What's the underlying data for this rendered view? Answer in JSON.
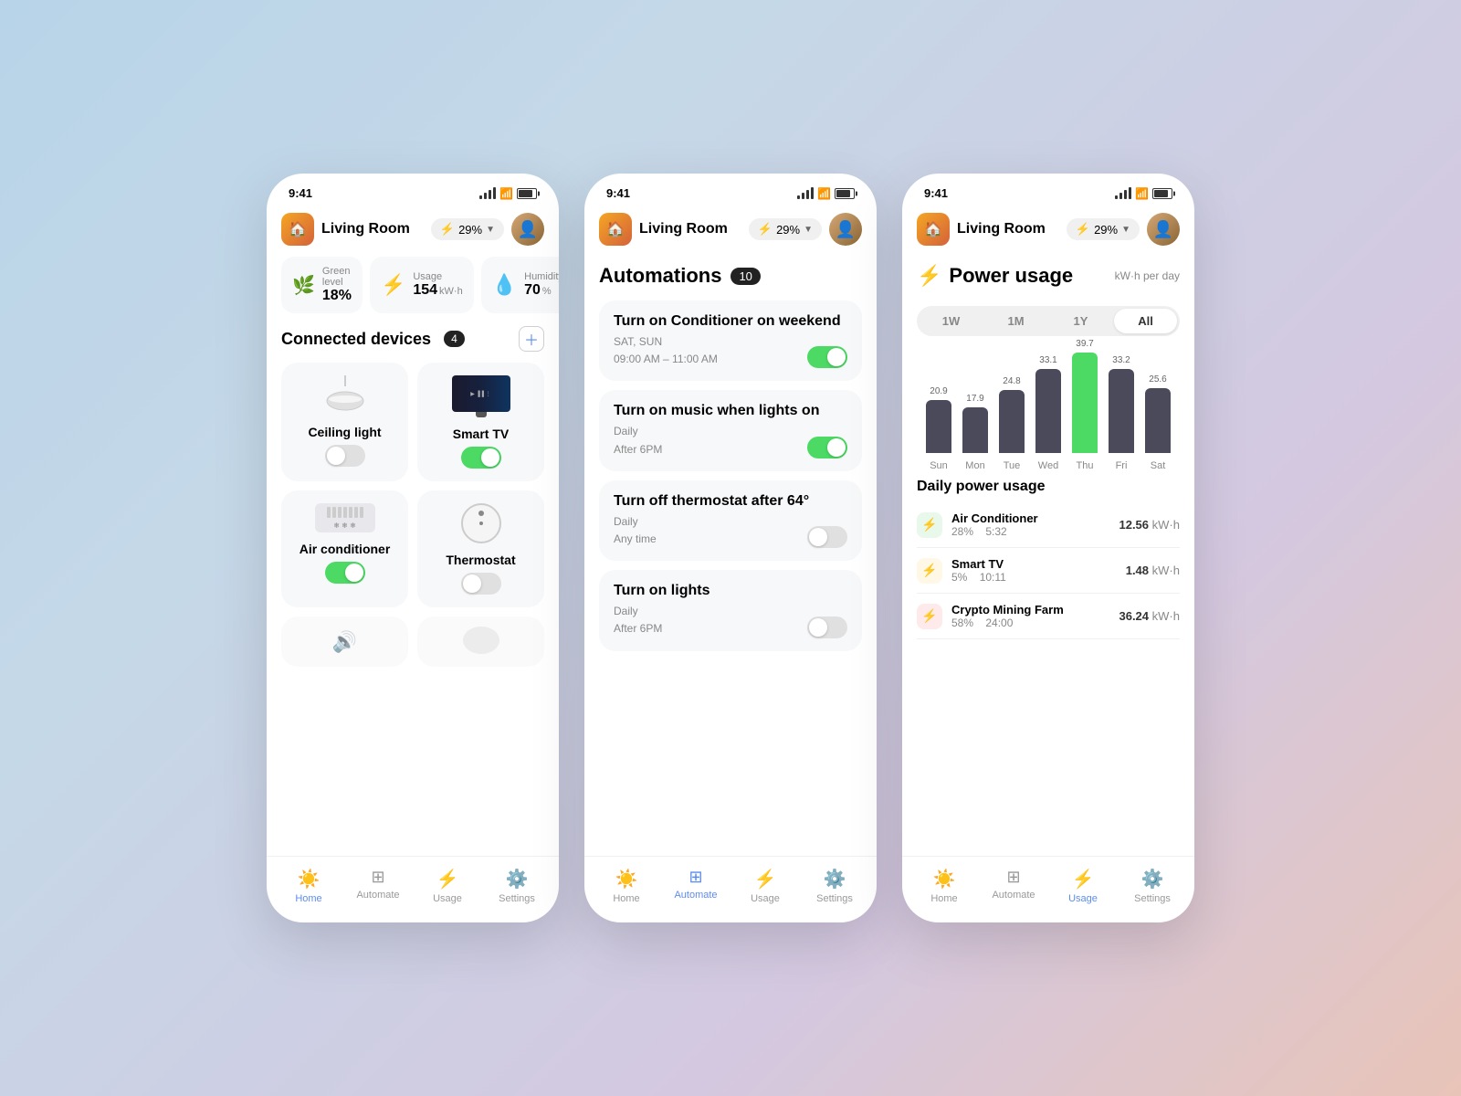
{
  "app": {
    "status_time": "9:41",
    "battery_pct": "29%"
  },
  "phone1": {
    "room": "Living Room",
    "stats": {
      "green_label": "Green level",
      "green_value": "18%",
      "usage_label": "Usage",
      "usage_value": "154",
      "usage_unit": "kW·h",
      "humidity_label": "Humidity",
      "humidity_value": "70",
      "humidity_unit": "%"
    },
    "connected_devices": {
      "title": "Connected devices",
      "count": "4",
      "devices": [
        {
          "name": "Ceiling light",
          "icon": "💡",
          "type": "ceiling",
          "on": false
        },
        {
          "name": "Smart TV",
          "icon": "📺",
          "type": "tv",
          "on": true
        },
        {
          "name": "Air conditioner",
          "icon": "❄️",
          "type": "ac",
          "on": true
        },
        {
          "name": "Thermostat",
          "icon": "🌡️",
          "type": "thermostat",
          "on": false
        }
      ]
    },
    "nav": {
      "items": [
        {
          "label": "Home",
          "icon": "☀️",
          "active": true
        },
        {
          "label": "Automate",
          "icon": "⊞",
          "active": false
        },
        {
          "label": "Usage",
          "icon": "⚡",
          "active": false
        },
        {
          "label": "Settings",
          "icon": "⚙️",
          "active": false
        }
      ]
    }
  },
  "phone2": {
    "room": "Living Room",
    "automations_title": "Automations",
    "automations_count": "10",
    "automations": [
      {
        "name": "Turn on Conditioner on weekend",
        "schedule_line1": "SAT, SUN",
        "schedule_line2": "09:00 AM – 11:00 AM",
        "on": true
      },
      {
        "name": "Turn on music when lights on",
        "schedule_line1": "Daily",
        "schedule_line2": "After 6PM",
        "on": true
      },
      {
        "name": "Turn off thermostat after 64°",
        "schedule_line1": "Daily",
        "schedule_line2": "Any time",
        "on": false
      },
      {
        "name": "Turn on lights",
        "schedule_line1": "Daily",
        "schedule_line2": "After 6PM",
        "on": false
      }
    ],
    "nav": {
      "items": [
        {
          "label": "Home",
          "icon": "☀️",
          "active": false
        },
        {
          "label": "Automate",
          "icon": "⊞",
          "active": true
        },
        {
          "label": "Usage",
          "icon": "⚡",
          "active": false
        },
        {
          "label": "Settings",
          "icon": "⚙️",
          "active": false
        }
      ]
    }
  },
  "phone3": {
    "room": "Living Room",
    "power_title": "Power usage",
    "power_subtitle": "kW·h per day",
    "period_tabs": [
      "1W",
      "1M",
      "1Y",
      "All"
    ],
    "active_period": "All",
    "chart": {
      "bars": [
        {
          "day": "Sun",
          "value": 20.9,
          "highlight": false
        },
        {
          "day": "Mon",
          "value": 17.9,
          "highlight": false
        },
        {
          "day": "Tue",
          "value": 24.8,
          "highlight": false
        },
        {
          "day": "Wed",
          "value": 33.1,
          "highlight": false
        },
        {
          "day": "Thu",
          "value": 39.7,
          "highlight": true
        },
        {
          "day": "Fri",
          "value": 33.2,
          "highlight": false
        },
        {
          "day": "Sat",
          "value": 25.6,
          "highlight": false
        }
      ],
      "max_value": 39.7
    },
    "daily_usage_title": "Daily power usage",
    "usage_items": [
      {
        "name": "Air Conditioner",
        "pct": "28%",
        "time": "5:32",
        "kwh": "12.56",
        "unit": "kW·h",
        "bolt_color": "green"
      },
      {
        "name": "Smart TV",
        "pct": "5%",
        "time": "10:11",
        "kwh": "1.48",
        "unit": "kW·h",
        "bolt_color": "yellow"
      },
      {
        "name": "Crypto Mining Farm",
        "pct": "58%",
        "time": "24:00",
        "kwh": "36.24",
        "unit": "kW·h",
        "bolt_color": "red"
      }
    ],
    "nav": {
      "items": [
        {
          "label": "Home",
          "icon": "☀️",
          "active": false
        },
        {
          "label": "Automate",
          "icon": "⊞",
          "active": false
        },
        {
          "label": "Usage",
          "icon": "⚡",
          "active": true
        },
        {
          "label": "Settings",
          "icon": "⚙️",
          "active": false
        }
      ]
    }
  }
}
